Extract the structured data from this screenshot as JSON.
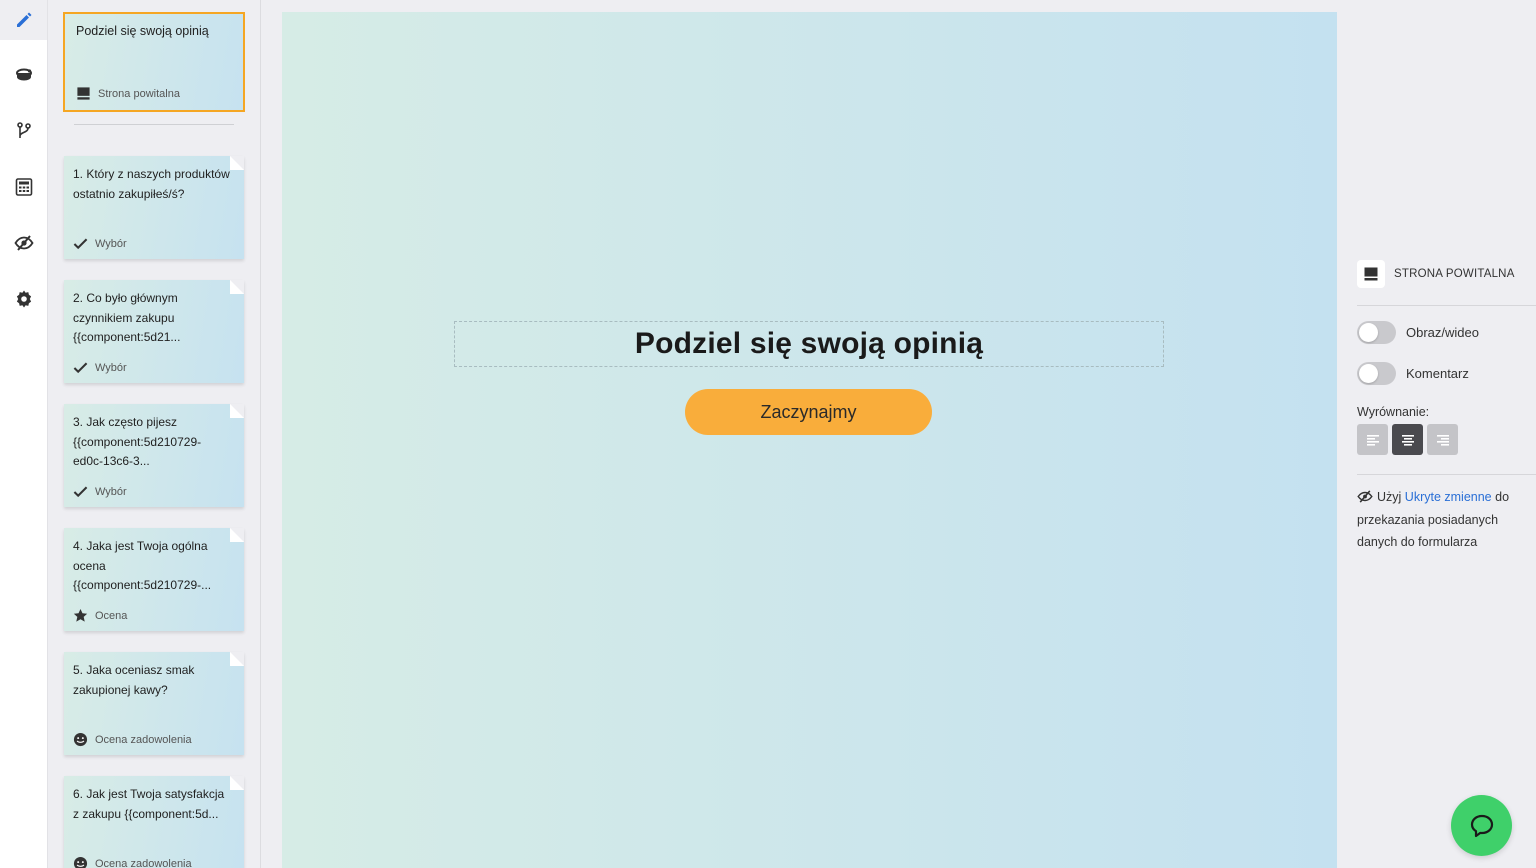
{
  "rail": {
    "items": [
      {
        "name": "edit",
        "icon": "pencil-icon",
        "active": true
      },
      {
        "name": "theme",
        "icon": "paint-bucket-icon"
      },
      {
        "name": "logic",
        "icon": "branch-icon"
      },
      {
        "name": "calculator",
        "icon": "calculator-icon"
      },
      {
        "name": "hidden-fields",
        "icon": "eye-slash-icon"
      },
      {
        "name": "settings",
        "icon": "gear-icon"
      }
    ]
  },
  "welcome_card": {
    "title": "Podziel się swoją opinią",
    "type_label": "Strona powitalna",
    "icon": "welcome-screen-icon"
  },
  "questions": [
    {
      "title": "1. Który z naszych produktów ostatnio zakupiłeś/ś?",
      "type_label": "Wybór",
      "icon": "check-icon"
    },
    {
      "title": "2. Co było głównym czynnikiem zakupu {{component:5d21...",
      "type_label": "Wybór",
      "icon": "check-icon"
    },
    {
      "title": "3. Jak często pijesz {{component:5d210729-ed0c-13c6-3...",
      "type_label": "Wybór",
      "icon": "check-icon"
    },
    {
      "title": "4. Jaka jest Twoja ogólna ocena {{component:5d210729-...",
      "type_label": "Ocena",
      "icon": "star-icon"
    },
    {
      "title": "5. Jaka oceniasz smak zakupionej kawy?",
      "type_label": "Ocena zadowolenia",
      "icon": "smiley-icon"
    },
    {
      "title": "6. Jak jest Twoja satysfakcja z zakupu {{component:5d...",
      "type_label": "Ocena zadowolenia",
      "icon": "smiley-icon"
    }
  ],
  "canvas": {
    "heading": "Podziel się swoją opinią",
    "button_label": "Zaczynajmy"
  },
  "panel": {
    "header": "STRONA POWITALNA",
    "toggles": [
      {
        "label": "Obraz/wideo",
        "on": false
      },
      {
        "label": "Komentarz",
        "on": false
      }
    ],
    "alignment_label": "Wyrównanie:",
    "alignment_options": [
      "left",
      "center",
      "right"
    ],
    "alignment_selected": "center",
    "hint_prefix": "Użyj",
    "hint_link": "Ukryte zmienne",
    "hint_suffix": "do przekazania posiadanych danych do formularza"
  },
  "colors": {
    "accent_orange": "#f9ad3b",
    "link_blue": "#2a6fd6",
    "chat_green": "#3fd06a",
    "active_icon_blue": "#2a6fd6"
  },
  "chat": {
    "icon": "chat-bubble-icon"
  }
}
